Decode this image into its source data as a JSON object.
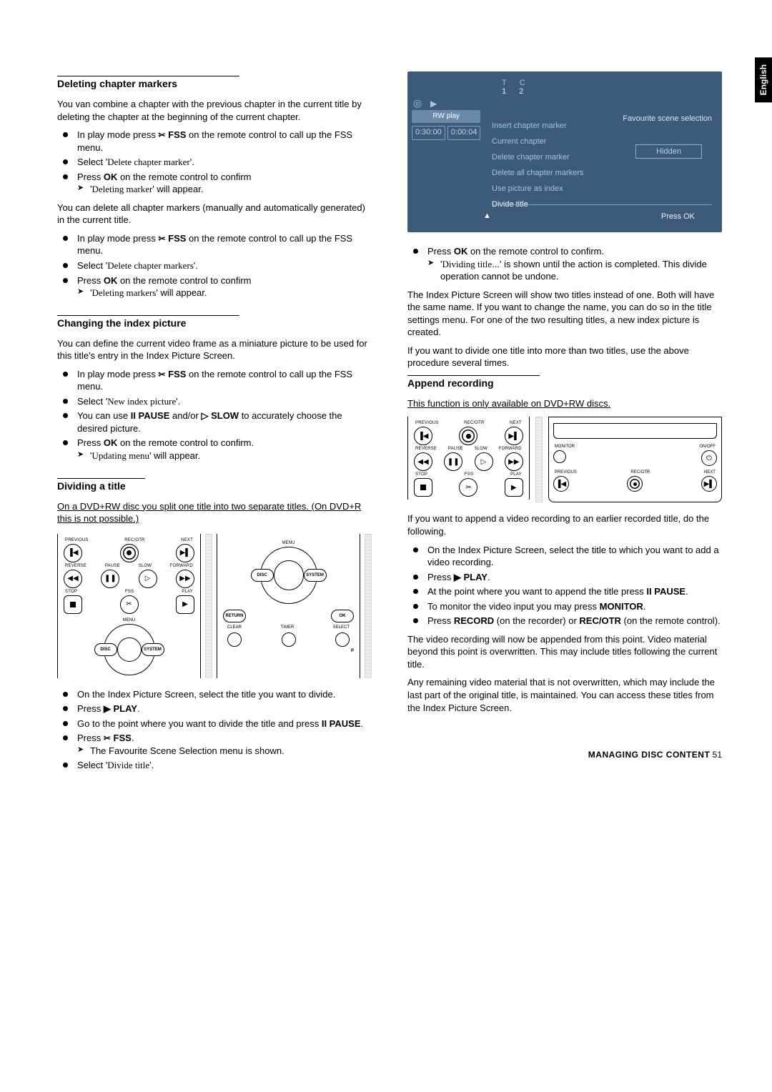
{
  "lang_tab": "English",
  "sections": {
    "del_markers": {
      "heading": "Deleting chapter markers",
      "p1": "You van combine a chapter with the previous chapter in the current title by deleting the chapter at the beginning of the current chapter.",
      "b1a": "In play mode press ",
      "b1b": " FSS",
      "b1c": " on the remote control to call up the FSS menu.",
      "b2a": "Select '",
      "b2b": "Delete chapter marker",
      "b2c": "'.",
      "b3a": "Press ",
      "b3b": "OK",
      "b3c": " on the remote control to confirm",
      "b3sub_a": "'",
      "b3sub_b": "Deleting marker",
      "b3sub_c": "' will appear.",
      "p2": "You can delete all chapter markers (manually and automatically generated) in the current title.",
      "b4a": "In play mode press ",
      "b4b": " FSS",
      "b4c": " on the remote control to call up the FSS menu.",
      "b5a": "Select '",
      "b5b": "Delete chapter markers",
      "b5c": "'.",
      "b6a": "Press ",
      "b6b": "OK",
      "b6c": " on the remote control to confirm",
      "b6sub_a": "'",
      "b6sub_b": "Deleting markers",
      "b6sub_c": "' will appear."
    },
    "index_pic": {
      "heading": "Changing the index picture",
      "p1": "You can define the current video frame as a miniature picture to be used for this title's entry in the Index Picture Screen.",
      "b1a": "In play mode press ",
      "b1b": " FSS",
      "b1c": " on the remote control to call up the FSS menu.",
      "b2a": "Select '",
      "b2b": "New index picture",
      "b2c": "'.",
      "b3a": "You can use ",
      "b3b": "II PAUSE",
      "b3c": " and/or ",
      "b3d": "▷ SLOW",
      "b3e": " to accurately choose the desired picture.",
      "b4a": "Press ",
      "b4b": "OK",
      "b4c": " on the remote control to confirm.",
      "b4sub_a": "'",
      "b4sub_b": "Updating menu",
      "b4sub_c": "' will appear."
    },
    "divide": {
      "heading": "Dividing a title",
      "heading_width_short": true,
      "p1": "On a DVD+RW disc you split one title into two separate titles. (On DVD+R this is not possible.)",
      "b1": "On the Index Picture Screen, select the title you want to divide.",
      "b2a": "Press ",
      "b2b": "▶ PLAY",
      "b2c": ".",
      "b3a": "Go to the point where you want to divide the title and press ",
      "b3b": "II PAUSE",
      "b3c": ".",
      "b4a": "Press ",
      "b4b": " FSS",
      "b4c": ".",
      "b4sub": "The Favourite Scene Selection menu is shown.",
      "b5a": "Select '",
      "b5b": "Divide title",
      "b5c": "'."
    },
    "col2": {
      "osd": {
        "tc1": "T",
        "tc2": "C",
        "n1": "1",
        "n2": "2",
        "rwplay": "RW play",
        "t_total": "0:30:00",
        "t_cur": "0:00:04",
        "fss": "Favourite scene selection",
        "hidden": "Hidden",
        "m1": "Insert chapter marker",
        "m2": "Current chapter",
        "m3": "Delete chapter marker",
        "m4": "Delete all chapter markers",
        "m5": "Use picture as index",
        "m6": "Divide title",
        "pressok": "Press OK"
      },
      "b1a": "Press ",
      "b1b": "OK",
      "b1c": " on the remote control to confirm.",
      "b1sub_a": "'",
      "b1sub_b": "Dividing title",
      "b1sub_c": "...' is shown until the action is completed. This divide operation cannot be undone.",
      "p1": "The Index Picture Screen will show two titles instead of one. Both will have the same name. If you want to change the name, you can do so in the title settings menu. For one of the two resulting titles, a new index picture is created.",
      "p2": "If you want to divide one title into more than two titles, use the above procedure several times.",
      "append_heading": "Append recording",
      "append_note": "This function is only available on DVD+RW discs.",
      "p3": "If you want to append a video recording to an earlier recorded title, do the following.",
      "ab1": "On the Index Picture Screen, select the title to which you want to add a video recording.",
      "ab2a": "Press ",
      "ab2b": "▶ PLAY",
      "ab2c": ".",
      "ab3a": "At the point where you want to append the title press ",
      "ab3b": "II PAUSE",
      "ab3c": ".",
      "ab4a": "To monitor the video input you may press ",
      "ab4b": "MONITOR",
      "ab4c": ".",
      "ab5a": "Press ",
      "ab5b": "RECORD",
      "ab5c": " (on the recorder) or ",
      "ab5d": "REC/OTR",
      "ab5e": " (on the remote control).",
      "p4": "The video recording will now be appended from this point. Video material beyond this point is overwritten. This may include titles following the current title.",
      "p5": "Any remaining video material that is not overwritten, which may include the last part of the original title, is maintained. You can access these titles from the Index Picture Screen."
    }
  },
  "remote_labels": {
    "prev": "PREVIOUS",
    "recotr": "REC/OTR",
    "next": "NEXT",
    "rev": "REVERSE",
    "pause": "PAUSE",
    "slow": "SLOW",
    "fwd": "FORWARD",
    "stop": "STOP",
    "fss": "FSS",
    "play": "PLAY",
    "menu": "MENU",
    "disc": "DISC",
    "system": "SYSTEM",
    "return": "RETURN",
    "ok": "OK",
    "clear": "CLEAR",
    "timer": "TIMER",
    "select": "SELECT",
    "p": "P",
    "monitor": "MONITOR",
    "onoff": "ON/OFF"
  },
  "footer": {
    "label": "MANAGING DISC CONTENT",
    "page": "51"
  },
  "scissor": "✂"
}
